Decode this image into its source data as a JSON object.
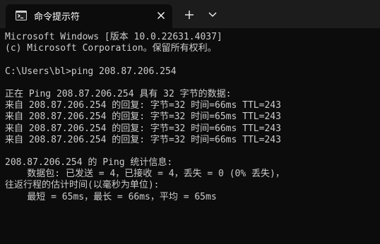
{
  "window": {
    "tab_title": "命令提示符",
    "tab_icon": "cmd-icon",
    "close_icon": "close-icon",
    "new_tab_icon": "plus-icon",
    "dropdown_icon": "chevron-down-icon"
  },
  "console": {
    "lines": [
      "Microsoft Windows [版本 10.0.22631.4037]",
      "(c) Microsoft Corporation。保留所有权利。",
      "",
      "C:\\Users\\bl>ping 208.87.206.254",
      "",
      "正在 Ping 208.87.206.254 具有 32 字节的数据:",
      "来自 208.87.206.254 的回复: 字节=32 时间=66ms TTL=243",
      "来自 208.87.206.254 的回复: 字节=32 时间=65ms TTL=243",
      "来自 208.87.206.254 的回复: 字节=32 时间=66ms TTL=243",
      "来自 208.87.206.254 的回复: 字节=32 时间=66ms TTL=243",
      "",
      "208.87.206.254 的 Ping 统计信息:",
      "    数据包: 已发送 = 4，已接收 = 4，丢失 = 0 (0% 丢失)，",
      "往返行程的估计时间(以毫秒为单位):",
      "    最短 = 65ms，最长 = 66ms，平均 = 65ms"
    ]
  },
  "colors": {
    "background": "#0c0c0c",
    "tabbar": "#1c1c1c",
    "text": "#cccccc"
  }
}
